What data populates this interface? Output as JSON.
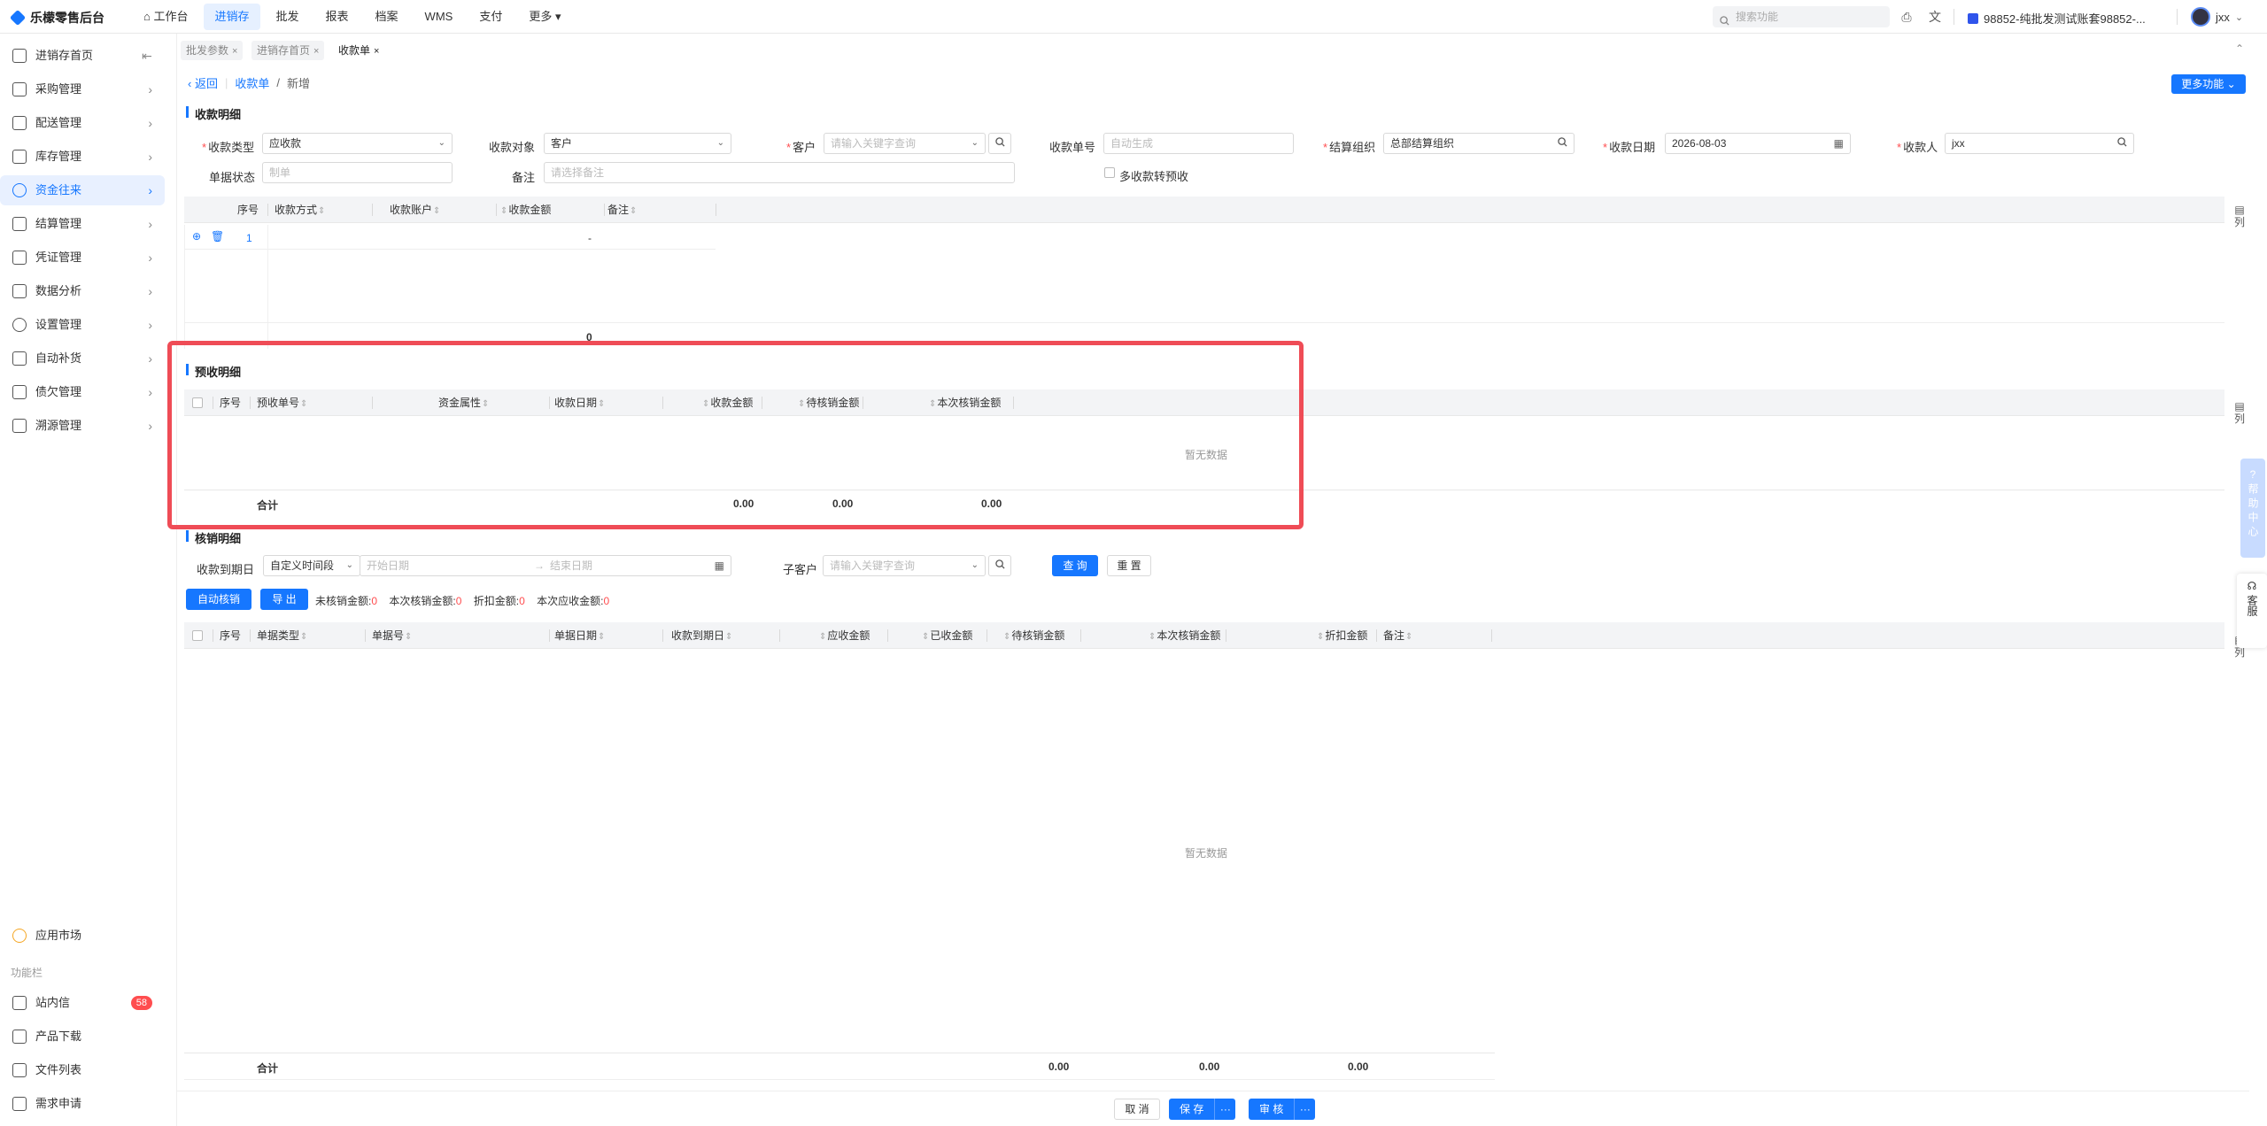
{
  "app": {
    "name": "乐檬零售后台"
  },
  "topnav": {
    "items": [
      "工作台",
      "进销存",
      "批发",
      "报表",
      "档案",
      "WMS",
      "支付",
      "更多"
    ],
    "search_placeholder": "搜索功能",
    "tenant": "98852-纯批发测试账套98852-...",
    "user": "jxx"
  },
  "sidebar": {
    "items": [
      "进销存首页",
      "采购管理",
      "配送管理",
      "库存管理",
      "资金往来",
      "结算管理",
      "凭证管理",
      "数据分析",
      "设置管理",
      "自动补货",
      "债欠管理",
      "溯源管理"
    ],
    "bottom": {
      "app_market": "应用市场",
      "section_label": "功能栏",
      "messages": "站内信",
      "messages_badge": "58",
      "download": "产品下载",
      "files": "文件列表",
      "requests": "需求申请"
    }
  },
  "tabs": [
    "批发参数",
    "进销存首页",
    "收款单"
  ],
  "breadcrumb": {
    "back": "返回",
    "parent": "收款单",
    "current": "新增"
  },
  "more_button": "更多功能",
  "receipt": {
    "title": "收款明细",
    "fields": {
      "type_label": "收款类型",
      "type_value": "应收款",
      "target_label": "收款对象",
      "target_value": "客户",
      "customer_label": "客户",
      "customer_placeholder": "请输入关键字查询",
      "no_label": "收款单号",
      "no_placeholder": "自动生成",
      "org_label": "结算组织",
      "org_value": "总部结算组织",
      "date_label": "收款日期",
      "date_value": "2026-08-03",
      "payee_label": "收款人",
      "payee_value": "jxx",
      "status_label": "单据状态",
      "status_value": "制单",
      "remark_label": "备注",
      "remark_placeholder": "请选择备注",
      "multi_label": "多收款转预收"
    },
    "columns": [
      "序号",
      "收款方式",
      "收款账户",
      "收款金额",
      "备注"
    ],
    "rows": [
      {
        "index": "1",
        "amount": "-"
      }
    ],
    "total": "0"
  },
  "prepaid": {
    "title": "预收明细",
    "columns": [
      "序号",
      "预收单号",
      "资金属性",
      "收款日期",
      "收款金额",
      "待核销金额",
      "本次核销金额"
    ],
    "empty": "暂无数据",
    "total_label": "合计",
    "totals": [
      "0.00",
      "0.00",
      "0.00"
    ]
  },
  "writeoff": {
    "title": "核销明细",
    "period_label": "收款到期日",
    "period_value": "自定义时间段",
    "start_placeholder": "开始日期",
    "end_placeholder": "结束日期",
    "sub_customer_label": "子客户",
    "sub_customer_placeholder": "请输入关键字查询",
    "query": "查 询",
    "reset": "重 置",
    "auto": "自动核销",
    "export": "导 出",
    "stats": [
      {
        "label": "未核销金额:",
        "value": "0"
      },
      {
        "label": "本次核销金额:",
        "value": "0"
      },
      {
        "label": "折扣金额:",
        "value": "0"
      },
      {
        "label": "本次应收金额:",
        "value": "0"
      }
    ],
    "columns": [
      "序号",
      "单据类型",
      "单据号",
      "单据日期",
      "收款到期日",
      "应收金额",
      "已收金额",
      "待核销金额",
      "本次核销金额",
      "折扣金额",
      "备注"
    ],
    "empty": "暂无数据",
    "total_label": "合计",
    "totals": [
      "0.00",
      "0.00",
      "0.00"
    ]
  },
  "column_setting": "列",
  "help": "帮助中心",
  "service": "客服",
  "footer": {
    "cancel": "取 消",
    "save": "保 存",
    "audit": "审 核",
    "more": "···"
  },
  "accent_color": "#1677ff",
  "highlight_color": "#ef4c56"
}
